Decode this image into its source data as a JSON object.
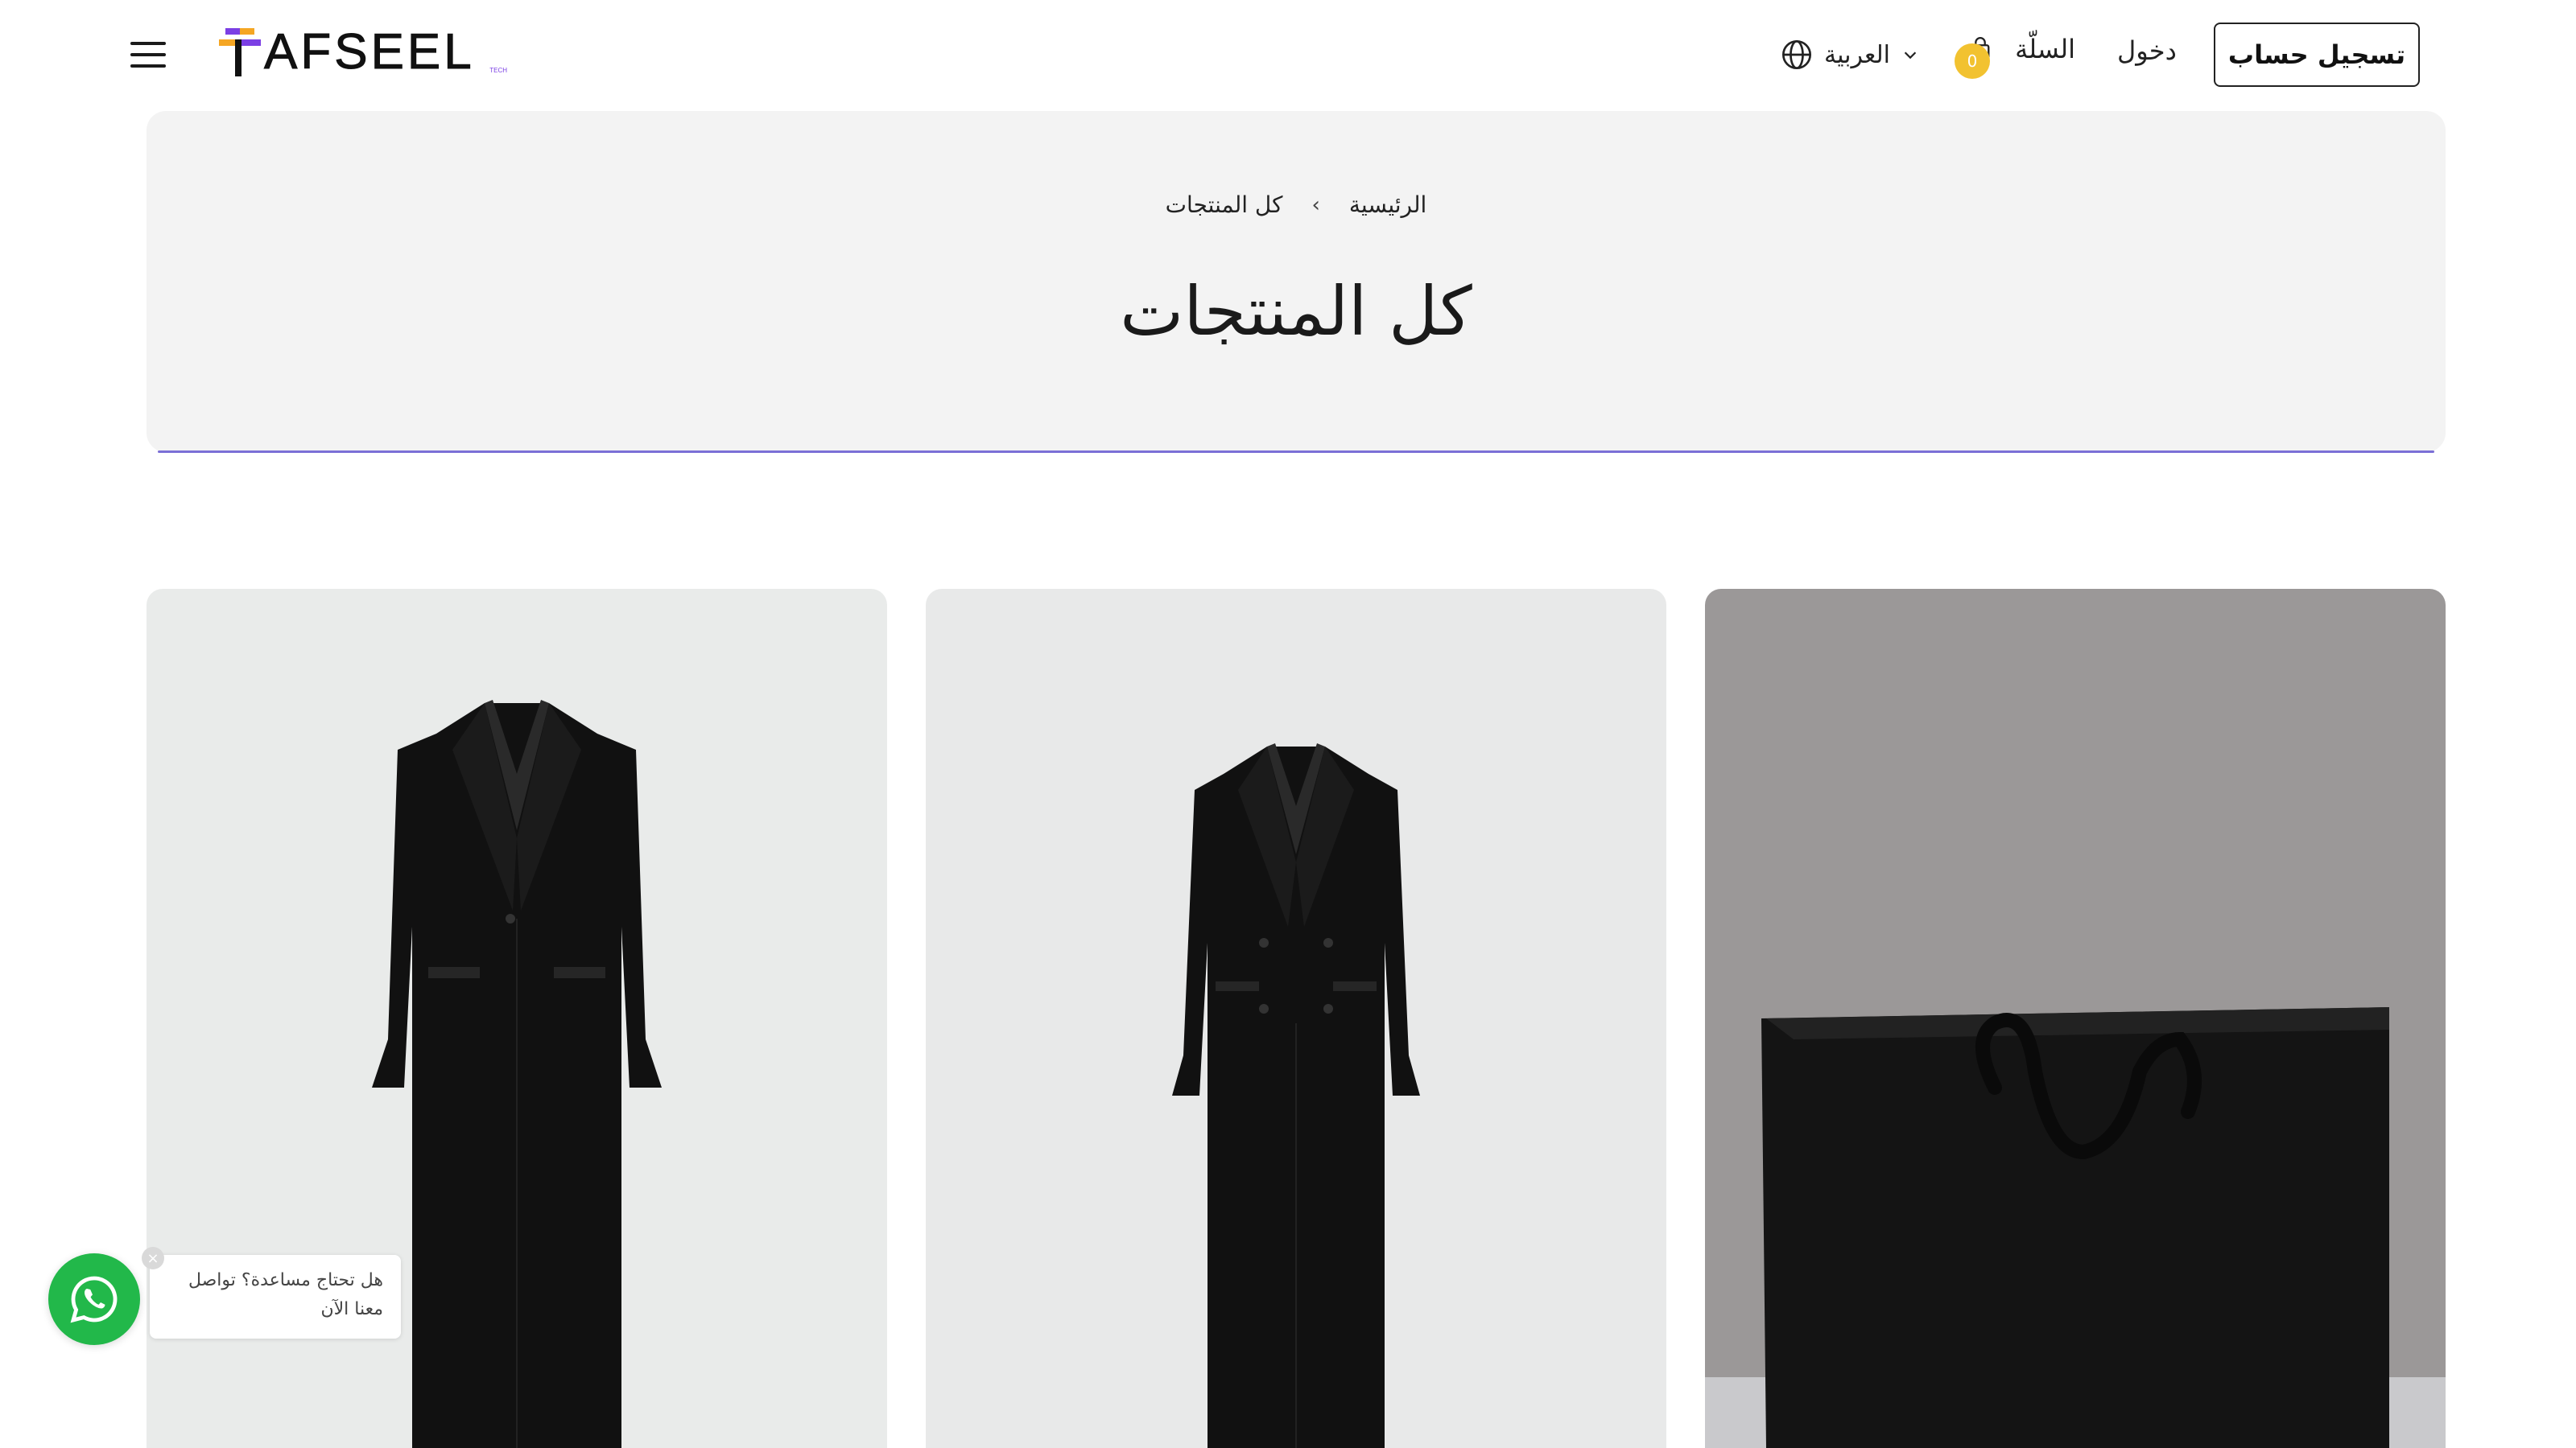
{
  "header": {
    "logo_text": "AFSEEL",
    "logo_sub": "TECH",
    "language": "العربية",
    "cart_label": "السلّة",
    "cart_count": "0",
    "login": "دخول",
    "register": "تسجيل حساب"
  },
  "breadcrumb": {
    "home": "الرئيسية",
    "separator": "›",
    "current": "كل المنتجات"
  },
  "page_title": "كل المنتجات",
  "products": [
    {
      "image": "black-single-breasted-long-coat"
    },
    {
      "image": "black-double-breasted-long-coat"
    },
    {
      "image": "black-shopping-bag"
    }
  ],
  "whatsapp": {
    "message": "هل تحتاج مساعدة؟ تواصل معنا الآن",
    "close": "×"
  },
  "colors": {
    "accent_purple": "#7b3fe4",
    "accent_orange": "#f5a623",
    "cart_badge": "#f2c230",
    "whatsapp_green": "#22b84a"
  }
}
